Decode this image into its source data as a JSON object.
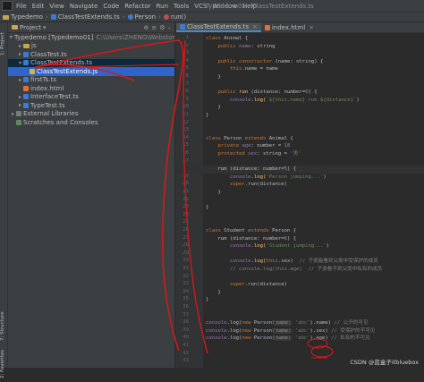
{
  "menu": {
    "items": [
      "File",
      "Edit",
      "View",
      "Navigate",
      "Code",
      "Refactor",
      "Run",
      "Tools",
      "VCS",
      "Window",
      "Help"
    ],
    "window_title": "Typedemo01 - ClassTestExtends.ts"
  },
  "breadcrumb": [
    "Typedemo",
    "ClassTestExtends.ts",
    "Person",
    "run()"
  ],
  "project_panel": {
    "title": "Project",
    "root_label": "Typedemo [Typedemo01]",
    "root_path": "C:\\Users\\ZHENG\\WebstormProjects\\Ty...",
    "items": [
      {
        "label": "js",
        "type": "folder"
      },
      {
        "label": "ClassTest.ts",
        "type": "ts"
      },
      {
        "label": "ClassTestExtends.ts",
        "type": "ts"
      },
      {
        "label": "ClassTestExtends.js",
        "type": "js"
      },
      {
        "label": "firstTs.ts",
        "type": "ts"
      },
      {
        "label": "index.html",
        "type": "html"
      },
      {
        "label": "InterfaceTest.ts",
        "type": "ts"
      },
      {
        "label": "TypeTest.ts",
        "type": "ts"
      },
      {
        "label": "External Libraries",
        "type": "lib"
      },
      {
        "label": "Scratches and Consoles",
        "type": "scratch"
      }
    ]
  },
  "side_tabs": {
    "project": "1: Project",
    "structure": "7: Structure",
    "favorites": "2: Favorites"
  },
  "tabs": [
    {
      "label": "ClassTestExtends.ts",
      "active": true
    },
    {
      "label": "index.html",
      "active": false
    }
  ],
  "line_numbers": [
    "1",
    "2",
    "3",
    "4",
    "5",
    "6",
    "7",
    "8",
    "9",
    "10",
    "11",
    "12",
    "13",
    "14",
    "15",
    "16",
    "17",
    "18",
    "19",
    "20",
    "21",
    "22",
    "23",
    "24",
    "25",
    "26",
    "27",
    "28",
    "29",
    "30",
    "31",
    "32",
    "33",
    "34",
    "35",
    "36",
    "37",
    "38",
    "39",
    "40",
    "41",
    "42",
    "43"
  ],
  "code": {
    "l1": {
      "kw": "class ",
      "name": "Animal {"
    },
    "l2": {
      "prop": "public ",
      "name": "name",
      "rest": ": string"
    },
    "l4": {
      "kw": "public constructor ",
      "rest": "(name: string) {"
    },
    "l5": {
      "kw": "this",
      "rest": ".name = name"
    },
    "l6": "}",
    "l8": {
      "kw": "public ",
      "fn": "run",
      "rest1": " (distance: number=",
      "num": "0",
      "rest2": ") {"
    },
    "l9": {
      "obj": "console",
      "fn": ".log(",
      "str": "`${this.name} run ${distance}`",
      "end": ")"
    },
    "l10": "}",
    "l11": "}",
    "l14": {
      "kw": "class ",
      "name": "Person ",
      "kw2": "extends ",
      "name2": "Animal {"
    },
    "l15": {
      "kw": "private ",
      "prop": "age",
      "rest": ": number = ",
      "num": "18"
    },
    "l16": {
      "kw": "protected ",
      "prop": "sex",
      "rest": ": string = ",
      "str": "'男'"
    },
    "l18": {
      "fn": "run",
      "rest1": " (distance: number=",
      "num": "5",
      "rest2": ") {"
    },
    "l19": {
      "obj": "console",
      "fn": ".log(",
      "str": "'Person jumping...'",
      "end": ")"
    },
    "l20": {
      "kw": "super",
      "rest": ".run(distance)"
    },
    "l21": "}",
    "l23": "}",
    "l26": {
      "kw": "class ",
      "name": "Student ",
      "kw2": "extends ",
      "name2": "Person {"
    },
    "l27": {
      "fn": "run",
      "rest1": " (distance: number=",
      "num": "6",
      "rest2": ") {"
    },
    "l28": {
      "obj": "console",
      "fn": ".log(",
      "str": "'Student jumping...'",
      "end": ")"
    },
    "l30": {
      "obj": "console",
      "fn": ".log(",
      "kw": "this",
      "rest": ".sex)",
      "cmt": "// 子类能看到父类中受保护的成员"
    },
    "l31": {
      "cmt": "// console.log(this.age)  // 子类看不到父类中私有的成员"
    },
    "l33": {
      "kw": "super",
      "rest": ".run(distance)"
    },
    "l34": "}",
    "l35": "}",
    "l38": {
      "obj": "console",
      "rest1": ".log(",
      "kw": "new ",
      "cls": "Person(",
      "hint": "name:",
      "str": "'abc'",
      "rest2": ").name)",
      "cmt": "// 公开的可见"
    },
    "l39": {
      "obj": "console",
      "rest1": ".log(",
      "kw": "new ",
      "cls": "Person(",
      "hint": "name:",
      "str": "'abc'",
      "rest2": ").sex)",
      "cmt": "// 受保护的不可见"
    },
    "l40": {
      "obj": "console",
      "rest1": ".log(",
      "kw": "new ",
      "cls": "Person(",
      "hint": "name:",
      "str": "'abc'",
      "rest2": ").age)",
      "cmt": "// 私有的不可见"
    }
  },
  "watermark": "CSDN @蓝盒子itbluebox",
  "colors": {
    "keyword": "#cc7832",
    "string": "#6a8759",
    "function": "#ffc66d",
    "comment": "#808080",
    "annotation": "#d11a1a"
  }
}
